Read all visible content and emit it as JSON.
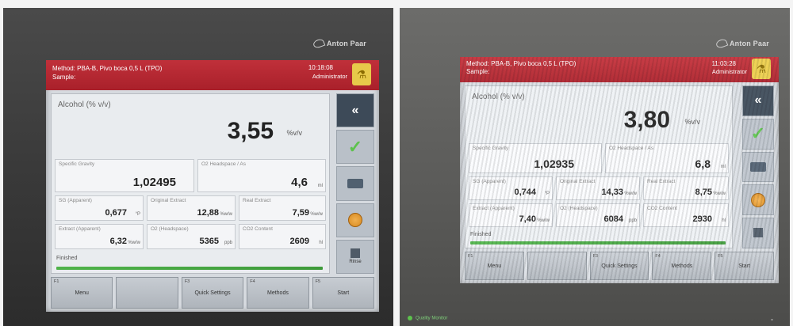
{
  "photos": [
    {
      "brand": "Anton Paar",
      "titlebar": {
        "method": "Method: PBA-B, Pivo boca 0,5 L (TPO)",
        "sample": "Sample:",
        "time": "10:18:08",
        "user": "Administrator"
      },
      "result": {
        "label": "Alcohol (% v/v)",
        "value": "3,55",
        "unit": "%v/v"
      },
      "cells": [
        {
          "label": "Specific Gravity",
          "value": "1,02495",
          "unit": ""
        },
        {
          "label": "O2 Headspace / As",
          "value": "4,6",
          "unit": "ml"
        },
        {
          "label": "SG (Apparent)",
          "value": "0,677",
          "unit": "°P"
        },
        {
          "label": "Original Extract",
          "value": "12,88",
          "unit": "%w/w"
        },
        {
          "label": "Real Extract",
          "value": "7,59",
          "unit": "%w/w"
        },
        {
          "label": "Extract (Apparent)",
          "value": "6,32",
          "unit": "%w/w"
        },
        {
          "label": "O2 (Headspace)",
          "value": "5365",
          "unit": "ppb"
        },
        {
          "label": "CO2 Content",
          "value": "2609",
          "unit": "hl"
        }
      ],
      "status": "Finished",
      "side": {
        "collapse": "«",
        "rinse": "Rinse"
      },
      "keys": [
        {
          "num": "F1",
          "label": "Menu"
        },
        {
          "num": "",
          "label": ""
        },
        {
          "num": "F3",
          "label": "Quick Settings"
        },
        {
          "num": "F4",
          "label": "Methods"
        },
        {
          "num": "F5",
          "label": "Start"
        }
      ]
    },
    {
      "brand": "Anton Paar",
      "titlebar": {
        "method": "Method: PBA-B, Pivo boca 0,5 L (TPO)",
        "sample": "Sample:",
        "time": "11:03:28",
        "user": "Administrator"
      },
      "result": {
        "label": "Alcohol (% v/v)",
        "value": "3,80",
        "unit": "%v/v"
      },
      "cells": [
        {
          "label": "Specific Gravity",
          "value": "1,02935",
          "unit": ""
        },
        {
          "label": "O2 Headspace / As",
          "value": "6,8",
          "unit": "ml"
        },
        {
          "label": "SG (Apparent)",
          "value": "0,744",
          "unit": "°P"
        },
        {
          "label": "Original Extract",
          "value": "14,33",
          "unit": "%w/w"
        },
        {
          "label": "Real Extract",
          "value": "8,75",
          "unit": "%w/w"
        },
        {
          "label": "Extract (Apparent)",
          "value": "7,40",
          "unit": "%w/w"
        },
        {
          "label": "O2 (Headspace)",
          "value": "6084",
          "unit": "ppb"
        },
        {
          "label": "CO2 Content",
          "value": "2930",
          "unit": "hl"
        }
      ],
      "status": "Finished",
      "side": {
        "collapse": "«",
        "rinse": ""
      },
      "keys": [
        {
          "num": "F1",
          "label": "Menu"
        },
        {
          "num": "",
          "label": ""
        },
        {
          "num": "F3",
          "label": "Quick Settings"
        },
        {
          "num": "F4",
          "label": "Methods"
        },
        {
          "num": "F5",
          "label": "Start"
        }
      ],
      "footer": "Quality Monitor"
    }
  ],
  "colors": {
    "titlebar": "#b02632",
    "accent_green": "#4fb34a",
    "side_dark": "#3d4a58"
  }
}
